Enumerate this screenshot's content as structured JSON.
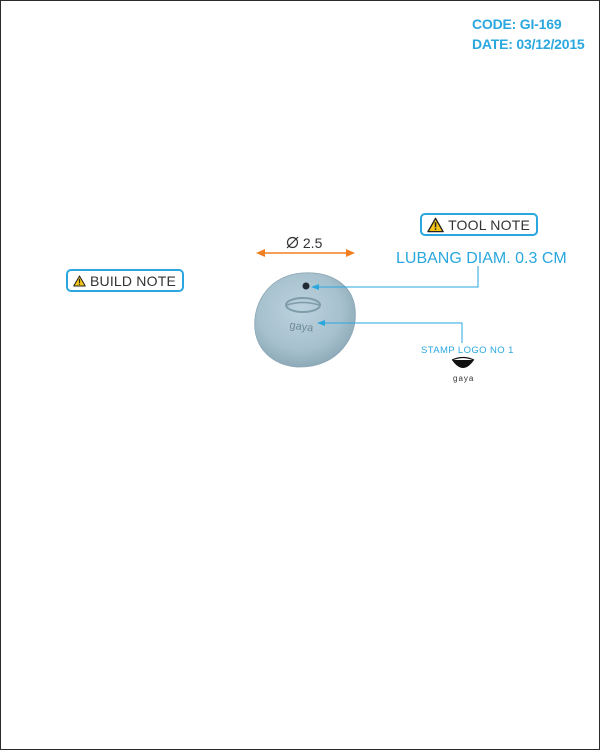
{
  "header": {
    "code": "CODE: GI-169",
    "date": "DATE: 03/12/2015"
  },
  "notes": {
    "build_note": "BUILD NOTE",
    "tool_note": "TOOL NOTE"
  },
  "annotations": {
    "hole_diameter": "LUBANG DIAM. 0.3 CM",
    "stamp_logo": "STAMP LOGO NO 1",
    "logo_text": "gaya",
    "dimension": "2.5",
    "pendant_stamp_text": "gaya"
  },
  "colors": {
    "accent": "#2aa7df",
    "dimension_arrow": "#f07f22",
    "pendant": "#a9c3d0"
  },
  "icons": {
    "warning": "warning-triangle-icon",
    "diameter": "diameter-symbol-icon",
    "logo": "gaya-bowl-logo-icon"
  }
}
